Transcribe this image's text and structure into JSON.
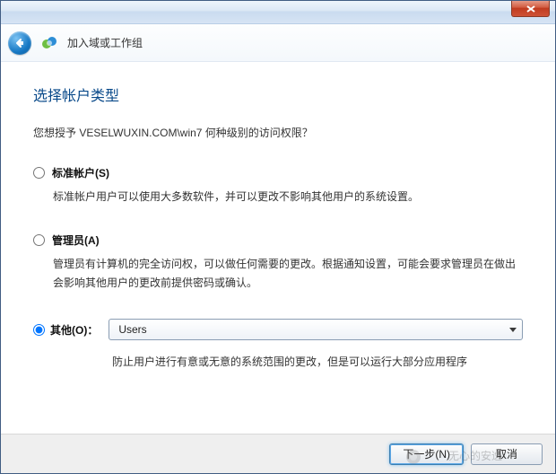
{
  "titlebar": {
    "close_tooltip": "关闭"
  },
  "header": {
    "wizard_title": "加入域或工作组"
  },
  "page": {
    "title": "选择帐户类型",
    "prompt": "您想授予 VESELWUXIN.COM\\win7 何种级别的访问权限？"
  },
  "options": {
    "standard": {
      "label": "标准帐户(S)",
      "desc": "标准帐户用户可以使用大多数软件，并可以更改不影响其他用户的系统设置。"
    },
    "admin": {
      "label": "管理员(A)",
      "desc": "管理员有计算机的完全访问权，可以做任何需要的更改。根据通知设置，可能会要求管理员在做出会影响其他用户的更改前提供密码或确认。"
    },
    "other": {
      "label": "其他(O)：",
      "selected": "Users",
      "desc": "防止用户进行有意或无意的系统范围的更改，但是可以运行大部分应用程序"
    }
  },
  "footer": {
    "next": "下一步(N)",
    "cancel": "取消"
  },
  "watermark": {
    "text": "无心的安逸"
  }
}
